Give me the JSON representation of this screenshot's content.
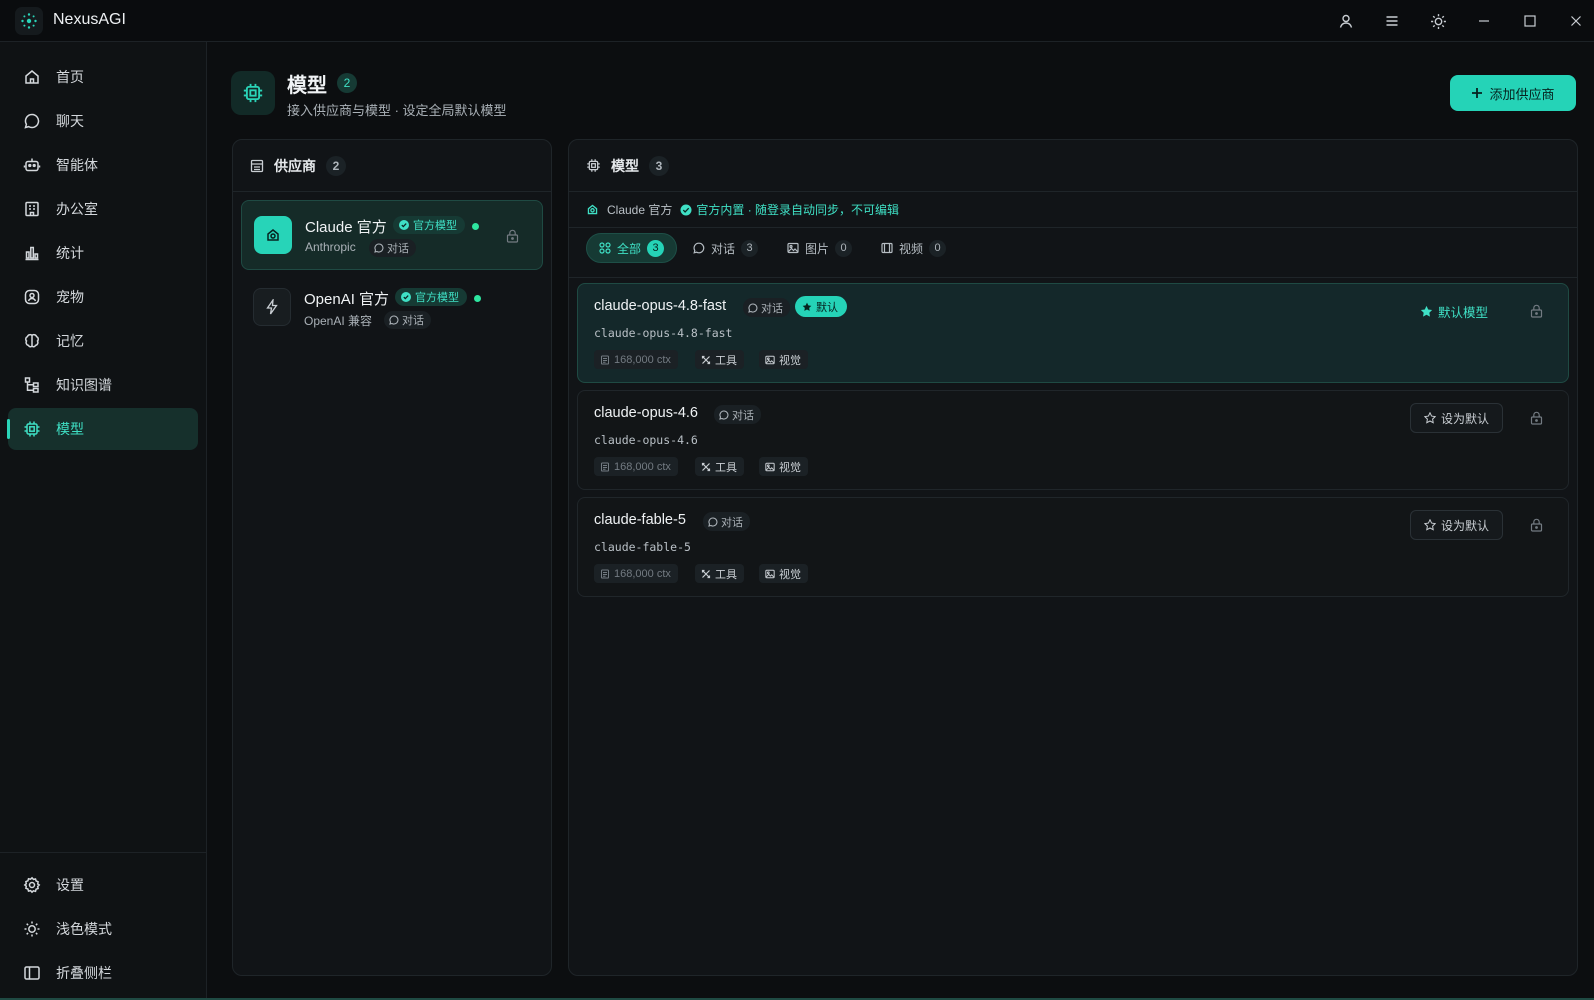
{
  "app": {
    "title": "NexusAGI"
  },
  "colors": {
    "accent": "#25d3b7",
    "accent_text": "#3fe0c5",
    "background": "#0c0e10",
    "status_dot": "#2ee6a0"
  },
  "sidebar": {
    "items": [
      {
        "label": "首页",
        "icon": "home-icon"
      },
      {
        "label": "聊天",
        "icon": "chat-bubble-icon"
      },
      {
        "label": "智能体",
        "icon": "robot-icon"
      },
      {
        "label": "办公室",
        "icon": "building-icon"
      },
      {
        "label": "统计",
        "icon": "bar-chart-icon"
      },
      {
        "label": "宠物",
        "icon": "pet-icon"
      },
      {
        "label": "记忆",
        "icon": "brain-icon"
      },
      {
        "label": "知识图谱",
        "icon": "knowledge-tree-icon"
      },
      {
        "label": "模型",
        "icon": "chip-icon",
        "active": true
      }
    ],
    "bottom": [
      {
        "label": "设置",
        "icon": "gear-icon"
      },
      {
        "label": "浅色模式",
        "icon": "sun-icon"
      },
      {
        "label": "折叠侧栏",
        "icon": "sidebar-collapse-icon"
      }
    ]
  },
  "header": {
    "title": "模型",
    "count": "2",
    "subtitle": "接入供应商与模型 · 设定全局默认模型",
    "add_button": "添加供应商"
  },
  "providers": {
    "title": "供应商",
    "count": "2",
    "items": [
      {
        "name": "Claude 官方",
        "tag": "官方模型",
        "subtitle": "Anthropic",
        "chip": "对话",
        "selected": true,
        "locked": true
      },
      {
        "name": "OpenAI 官方",
        "tag": "官方模型",
        "subtitle": "OpenAI 兼容",
        "chip": "对话",
        "selected": false,
        "locked": false
      }
    ]
  },
  "models": {
    "title": "模型",
    "count": "3",
    "provider_name": "Claude 官方",
    "provider_note": "官方内置 · 随登录自动同步，不可编辑",
    "tabs": [
      {
        "label": "全部",
        "count": "3",
        "active": true
      },
      {
        "label": "对话",
        "count": "3"
      },
      {
        "label": "图片",
        "count": "0"
      },
      {
        "label": "视频",
        "count": "0"
      }
    ],
    "items": [
      {
        "name": "claude-opus-4.8-fast",
        "id": "claude-opus-4.8-fast",
        "chip": "对话",
        "default_badge": "默认",
        "action": "默认模型",
        "ctx": "168,000 ctx",
        "tool": "工具",
        "vision": "视觉",
        "is_default": true
      },
      {
        "name": "claude-opus-4.6",
        "id": "claude-opus-4.6",
        "chip": "对话",
        "action": "设为默认",
        "ctx": "168,000 ctx",
        "tool": "工具",
        "vision": "视觉",
        "is_default": false
      },
      {
        "name": "claude-fable-5",
        "id": "claude-fable-5",
        "chip": "对话",
        "action": "设为默认",
        "ctx": "168,000 ctx",
        "tool": "工具",
        "vision": "视觉",
        "is_default": false
      }
    ]
  }
}
